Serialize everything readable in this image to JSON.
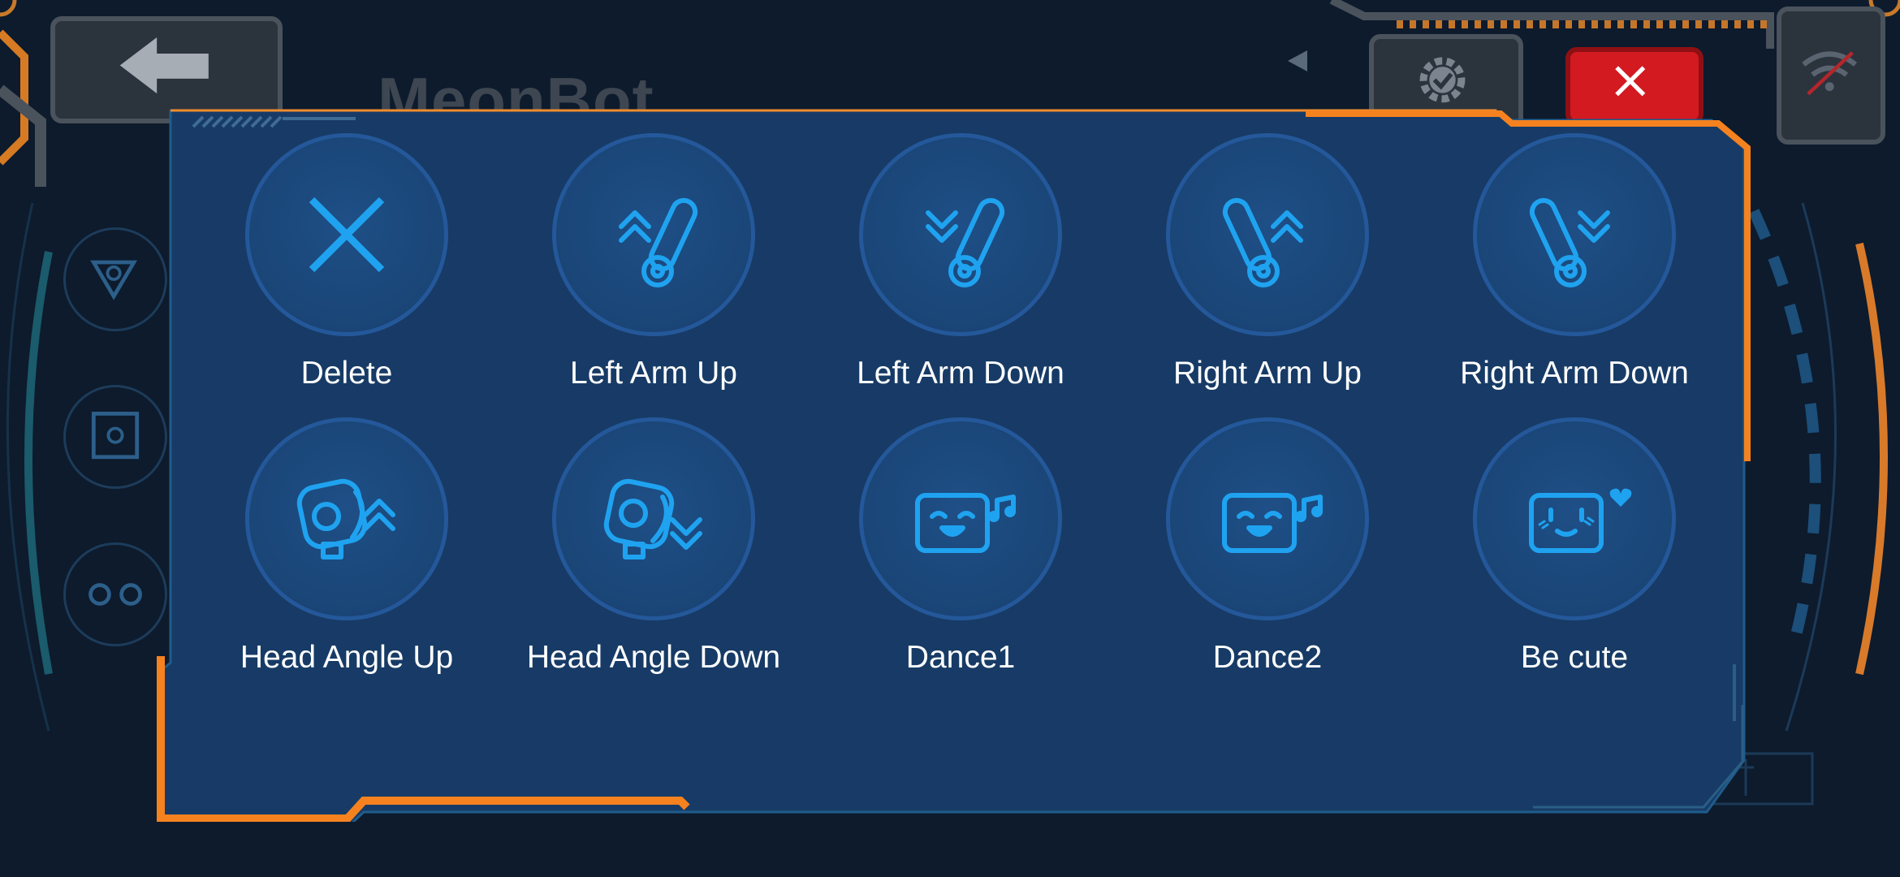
{
  "app": {
    "title": "MeonBot"
  },
  "colors": {
    "accent_orange": "#f5821f",
    "panel_bg": "#173b66",
    "icon_blue": "#1fa3f0",
    "close_red": "#d31a21",
    "label_white": "#ffffff"
  },
  "header": {
    "back_icon": "arrow-left-icon",
    "settings_icon": "gear-check-icon",
    "close_icon": "close-x-icon",
    "status_icon": "wifi-off-icon"
  },
  "actions": [
    {
      "label": "Delete",
      "icon": "delete-x-icon"
    },
    {
      "label": "Left Arm Up",
      "icon": "left-arm-up-icon"
    },
    {
      "label": "Left Arm Down",
      "icon": "left-arm-down-icon"
    },
    {
      "label": "Right Arm Up",
      "icon": "right-arm-up-icon"
    },
    {
      "label": "Right Arm Down",
      "icon": "right-arm-down-icon"
    },
    {
      "label": "Head Angle Up",
      "icon": "head-angle-up-icon"
    },
    {
      "label": "Head Angle Down",
      "icon": "head-angle-down-icon"
    },
    {
      "label": "Dance1",
      "icon": "dance-face-icon"
    },
    {
      "label": "Dance2",
      "icon": "dance-face-icon"
    },
    {
      "label": "Be cute",
      "icon": "cute-face-icon"
    }
  ]
}
